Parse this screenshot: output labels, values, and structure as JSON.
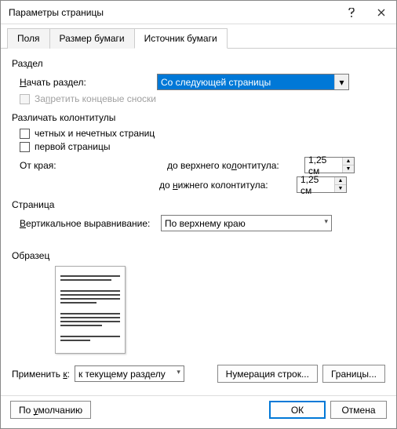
{
  "title": "Параметры страницы",
  "tabs": {
    "fields": "Поля",
    "paper_size": "Размер бумаги",
    "paper_source": "Источник бумаги"
  },
  "section": {
    "group": "Раздел",
    "start_label": "Начать раздел:",
    "start_label_pre": "",
    "start_label_ul": "Н",
    "start_label_post": "ачать раздел:",
    "start_value": "Со следующей страницы",
    "suppress_prefix": "За",
    "suppress_ul": "п",
    "suppress_suffix": "ретить концевые сноски"
  },
  "headers": {
    "group": "Различать колонтитулы",
    "odd_even": "четных и нечетных страниц",
    "first_page": "первой страницы",
    "from_edge": "От края:",
    "header_dist_pre": "до верхнего ко",
    "header_dist_ul": "л",
    "header_dist_post": "онтитула:",
    "footer_dist_pre": "до ",
    "footer_dist_ul": "н",
    "footer_dist_post": "ижнего колонтитула:",
    "header_val": "1,25 см",
    "footer_val": "1,25 см"
  },
  "page": {
    "group": "Страница",
    "valign_pre": "",
    "valign_ul": "В",
    "valign_post": "ертикальное выравнивание:",
    "valign_value": "По верхнему краю"
  },
  "preview": {
    "group": "Образец"
  },
  "apply": {
    "label_pre": "Применить ",
    "label_ul": "к",
    "label_post": ":",
    "value": "к текущему разделу"
  },
  "buttons": {
    "line_numbers": "Нумерация строк...",
    "borders": "Границы...",
    "default_pre": "По ",
    "default_ul": "у",
    "default_post": "молчанию",
    "ok": "ОК",
    "cancel": "Отмена"
  }
}
